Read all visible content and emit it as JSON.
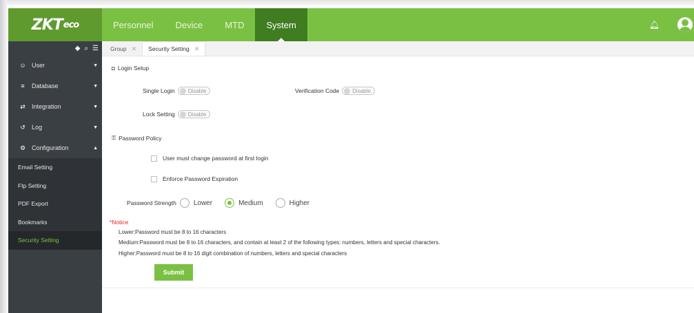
{
  "brand": {
    "logo": "ZKT",
    "logo_suffix": "eco",
    "accent": "#7ac143",
    "accent_dark": "#3f7d20"
  },
  "header": {
    "nav": [
      {
        "label": "Personnel",
        "active": false
      },
      {
        "label": "Device",
        "active": false
      },
      {
        "label": "MTD",
        "active": false
      },
      {
        "label": "System",
        "active": true
      }
    ],
    "icons": [
      "bell-icon",
      "user-avatar-icon"
    ]
  },
  "sidebar": {
    "tools": [
      "tag-icon",
      "search-icon",
      "list-icon"
    ],
    "items": [
      {
        "label": "User",
        "icon": "users-icon",
        "expanded": false
      },
      {
        "label": "Database",
        "icon": "database-icon",
        "expanded": false
      },
      {
        "label": "Integration",
        "icon": "swap-icon",
        "expanded": false
      },
      {
        "label": "Log",
        "icon": "history-icon",
        "expanded": false
      },
      {
        "label": "Configuration",
        "icon": "cogs-icon",
        "expanded": true
      }
    ],
    "sub_items": [
      {
        "label": "Email Setting",
        "active": false
      },
      {
        "label": "Ftp Setting",
        "active": false
      },
      {
        "label": "PDF Export",
        "active": false
      },
      {
        "label": "Bookmarks",
        "active": false
      },
      {
        "label": "Security Setting",
        "active": true
      }
    ]
  },
  "tabs": [
    {
      "label": "Group",
      "active": false
    },
    {
      "label": "Security Setting",
      "active": true
    }
  ],
  "login_setup": {
    "title": "Login Setup",
    "single_login": {
      "label": "Single Login",
      "state": "Disable"
    },
    "verification_code": {
      "label": "Verification Code",
      "state": "Disable"
    },
    "lock_setting": {
      "label": "Lock Setting",
      "state": "Disable"
    }
  },
  "password_policy": {
    "title": "Password Policy",
    "change_first_login": {
      "label": "User must change password at first login",
      "checked": false
    },
    "enforce_expiration": {
      "label": "Enforce Password Expiration",
      "checked": false
    },
    "strength": {
      "label": "Password Strength",
      "options": [
        "Lower",
        "Medium",
        "Higher"
      ],
      "selected": "Medium"
    }
  },
  "notice": {
    "title": "*Notice",
    "lines": [
      "Lower:Password must be 8 to 16 characters",
      "Medium:Password must be 8 to 16 characters, and contain at least 2 of the following types: numbers, letters and special characters.",
      "Higher:Password must be 8 to 16 digit combination of numbers, letters and special characters"
    ]
  },
  "submit_label": "Submit"
}
